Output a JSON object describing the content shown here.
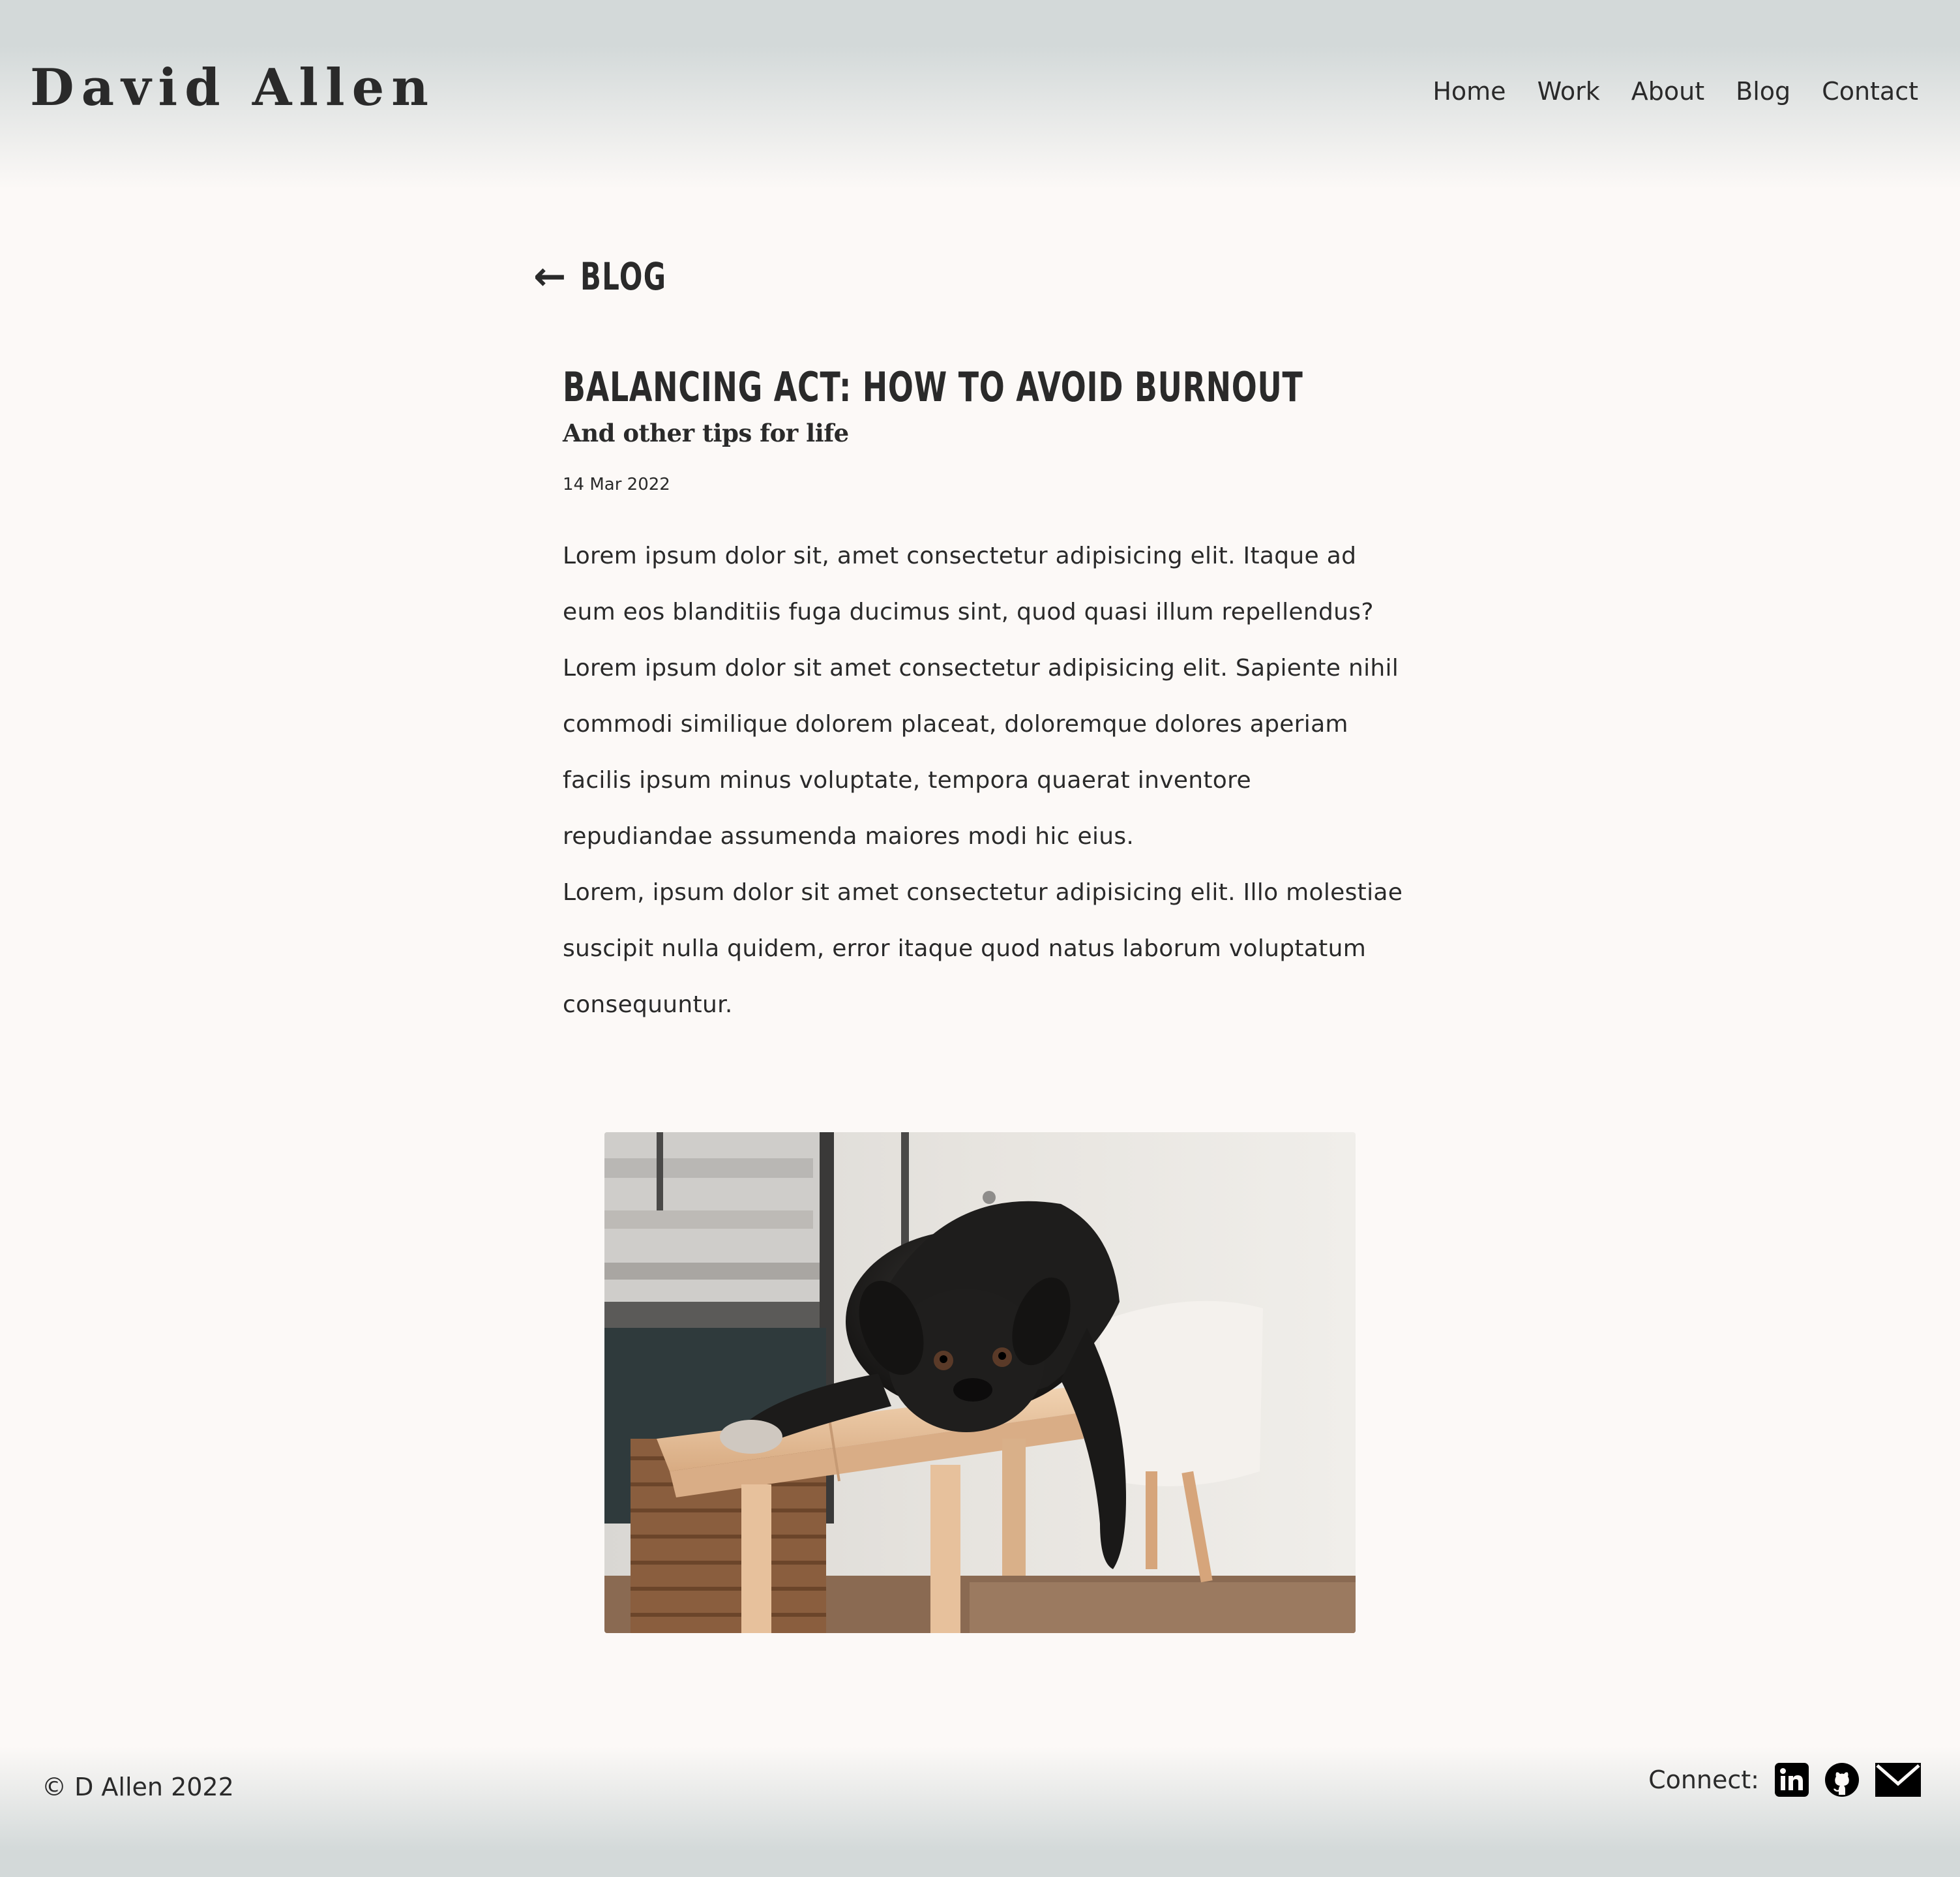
{
  "site": {
    "logo": "David Allen"
  },
  "nav": {
    "items": [
      "Home",
      "Work",
      "About",
      "Blog",
      "Contact"
    ]
  },
  "back_link": {
    "arrow": "←",
    "label": "BLOG"
  },
  "post": {
    "title": "BALANCING ACT: HOW TO AVOID BURNOUT",
    "subtitle": "And other tips for life",
    "date": "14 Mar 2022",
    "paragraphs": [
      "Lorem ipsum dolor sit, amet consectetur adipisicing elit. Itaque ad eum eos blanditiis fuga ducimus sint, quod quasi illum repellendus?",
      "Lorem ipsum dolor sit amet consectetur adipisicing elit. Sapiente nihil commodi similique dolorem placeat, doloremque dolores aperiam facilis ipsum minus voluptate, tempora quaerat inventore repudiandae assumenda maiores modi hic eius.",
      "Lorem, ipsum dolor sit amet consectetur adipisicing elit. Illo molestiae suscipit nulla quidem, error itaque quod natus laborum voluptatum consequuntur."
    ]
  },
  "footer": {
    "copyright": "© D Allen 2022",
    "connect_label": "Connect:",
    "icons": [
      "linkedin-icon",
      "github-icon",
      "email-icon"
    ]
  },
  "colors": {
    "text": "#2a2a2a",
    "background": "#fcf9f7",
    "header_band": "#d3d9d9"
  }
}
